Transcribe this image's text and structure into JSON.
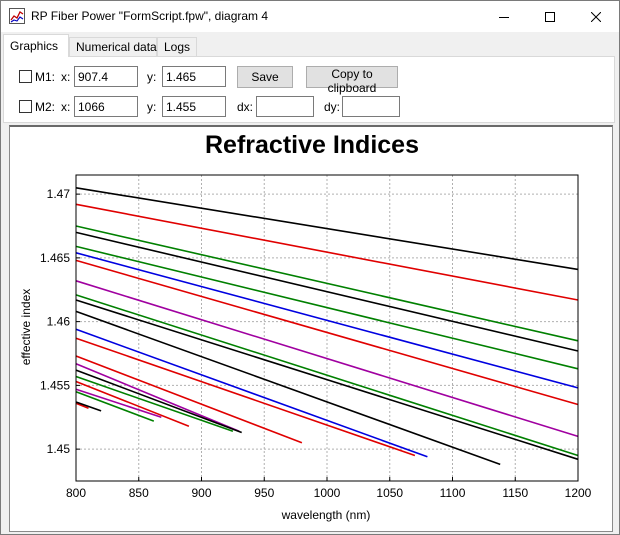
{
  "window": {
    "title": "RP Fiber Power \"FormScript.fpw\", diagram 4",
    "minimize_icon": "minimize-icon",
    "maximize_icon": "maximize-icon",
    "close_icon": "close-icon"
  },
  "tabs": [
    {
      "label": "Graphics",
      "active": true
    },
    {
      "label": "Numerical data",
      "active": false
    },
    {
      "label": "Logs",
      "active": false
    }
  ],
  "markers": {
    "m1": {
      "label": "M1:",
      "checked": false,
      "x_label": "x:",
      "x_value": "907.4",
      "y_label": "y:",
      "y_value": "1.465"
    },
    "m2": {
      "label": "M2:",
      "checked": false,
      "x_label": "x:",
      "x_value": "1066",
      "y_label": "y:",
      "y_value": "1.455",
      "dx_label": "dx:",
      "dx_value": "",
      "dy_label": "dy:",
      "dy_value": ""
    }
  },
  "buttons": {
    "save": "Save",
    "copy": "Copy to clipboard"
  },
  "chart_data": {
    "type": "line",
    "title": "Refractive Indices",
    "xlabel": "wavelength (nm)",
    "ylabel": "effective index",
    "xlim": [
      800,
      1200
    ],
    "ylim": [
      1.4475,
      1.4715
    ],
    "xticks": [
      800,
      850,
      900,
      950,
      1000,
      1050,
      1100,
      1150,
      1200
    ],
    "yticks": [
      1.45,
      1.455,
      1.46,
      1.465,
      1.47
    ],
    "ytick_labels": [
      "1.45",
      "1.455",
      "1.46",
      "1.465",
      "1.47"
    ],
    "grid": true,
    "colors": {
      "black": "#000000",
      "red": "#e00000",
      "green": "#008000",
      "blue": "#0000e0",
      "purple": "#a000a0"
    },
    "series": [
      {
        "color": "black",
        "x": [
          800,
          1200
        ],
        "y": [
          1.4705,
          1.4641
        ]
      },
      {
        "color": "red",
        "x": [
          800,
          1200
        ],
        "y": [
          1.4692,
          1.4617
        ]
      },
      {
        "color": "green",
        "x": [
          800,
          1200
        ],
        "y": [
          1.4675,
          1.4585
        ]
      },
      {
        "color": "black",
        "x": [
          800,
          1200
        ],
        "y": [
          1.467,
          1.4577
        ]
      },
      {
        "color": "green",
        "x": [
          800,
          1200
        ],
        "y": [
          1.4659,
          1.4563
        ]
      },
      {
        "color": "red",
        "x": [
          800,
          1200
        ],
        "y": [
          1.4648,
          1.4535
        ]
      },
      {
        "color": "blue",
        "x": [
          800,
          1200
        ],
        "y": [
          1.4654,
          1.4548
        ]
      },
      {
        "color": "purple",
        "x": [
          800,
          1200
        ],
        "y": [
          1.4632,
          1.451
        ]
      },
      {
        "color": "green",
        "x": [
          800,
          1200
        ],
        "y": [
          1.4621,
          1.4495
        ]
      },
      {
        "color": "black",
        "x": [
          800,
          1200
        ],
        "y": [
          1.4617,
          1.4492
        ]
      },
      {
        "color": "black",
        "x": [
          800,
          1138
        ],
        "y": [
          1.4608,
          1.4488
        ]
      },
      {
        "color": "blue",
        "x": [
          800,
          1080
        ],
        "y": [
          1.4594,
          1.4494
        ]
      },
      {
        "color": "red",
        "x": [
          800,
          1070
        ],
        "y": [
          1.4587,
          1.4495
        ]
      },
      {
        "color": "red",
        "x": [
          800,
          980
        ],
        "y": [
          1.4573,
          1.4505
        ]
      },
      {
        "color": "purple",
        "x": [
          800,
          930
        ],
        "y": [
          1.4567,
          1.4514
        ]
      },
      {
        "color": "black",
        "x": [
          800,
          932
        ],
        "y": [
          1.4562,
          1.4513
        ]
      },
      {
        "color": "green",
        "x": [
          800,
          925
        ],
        "y": [
          1.4557,
          1.4514
        ]
      },
      {
        "color": "red",
        "x": [
          800,
          890
        ],
        "y": [
          1.4553,
          1.4518
        ]
      },
      {
        "color": "purple",
        "x": [
          800,
          868
        ],
        "y": [
          1.4547,
          1.4525
        ]
      },
      {
        "color": "green",
        "x": [
          800,
          862
        ],
        "y": [
          1.4545,
          1.4522
        ]
      },
      {
        "color": "red",
        "x": [
          800,
          810
        ],
        "y": [
          1.4536,
          1.4532
        ]
      },
      {
        "color": "black",
        "x": [
          800,
          820
        ],
        "y": [
          1.4537,
          1.453
        ]
      }
    ]
  }
}
